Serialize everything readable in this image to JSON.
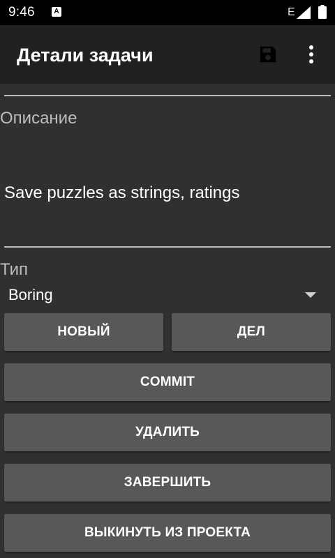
{
  "status_bar": {
    "time": "9:46",
    "notification_letter": "A",
    "network": "E"
  },
  "app_bar": {
    "title": "Детали задачи",
    "icons": [
      "save-icon",
      "more-vert-icon"
    ]
  },
  "form": {
    "description_label": "Описание",
    "description_value": "Save puzzles as strings, ratings",
    "type_label": "Тип",
    "type_value": "Boring"
  },
  "buttons": {
    "new": "НОВЫЙ",
    "del": "ДЕЛ",
    "commit": "COMMIT",
    "delete": "УДАЛИТЬ",
    "finish": "ЗАВЕРШИТЬ",
    "remove_from_project": "ВЫКИНУТЬ ИЗ ПРОЕКТА"
  },
  "colors": {
    "background": "#303030",
    "app_bar": "#212121",
    "status_bar": "#000000",
    "button": "#585858",
    "label": "#bdbdbd"
  }
}
